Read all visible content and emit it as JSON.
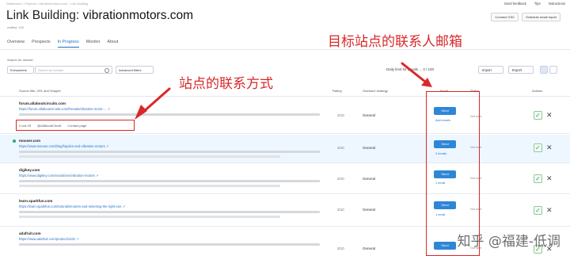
{
  "breadcrumb": "Dashboard  ›  Projects  ›  vibrationmotors.com  ›  Link Building",
  "top_links": [
    "Send feedback",
    "Tips",
    "Instructions"
  ],
  "page": {
    "title_prefix": "Link Building:",
    "title_domain": "vibrationmotors.com",
    "subtitle": "maillist: 100"
  },
  "header_buttons": [
    "Connect GSC",
    "Schedule email report"
  ],
  "tabs": [
    "Overview",
    "Prospects",
    "In Progress",
    "Monitor",
    "About"
  ],
  "filters": {
    "search_label": "Search for domain",
    "scope": "Everywhere",
    "search_placeholder": "Search by domain",
    "advanced": "Advanced filters",
    "daily_limit": "Daily limit for emails ... 3 / 100",
    "import": "Import",
    "export": "Export"
  },
  "columns": [
    "Source title, URL and Snippet",
    "Rating",
    "Outreach strategy",
    "Email",
    "Status",
    "Actions"
  ],
  "rows": [
    {
      "domain": "forum.allaboutcircuits.com",
      "url": "https://forum.allaboutcircuits.com/threads/vibration-motor-... ↗",
      "rating": "3/10",
      "strategy": "General",
      "email_btn": "Send",
      "email_count": "Add emails",
      "status": "Not sent",
      "contacts": [
        "f Link 93",
        "@AllAboutCircuit",
        "Contact page"
      ]
    },
    {
      "domain": "mouser.com",
      "url": "https://www.mouser.com/blog/haptics-and-vibration-motors ↗",
      "rating": "3/10",
      "strategy": "General",
      "email_btn": "Send",
      "email_count": "3 emails",
      "status": "Not sent"
    },
    {
      "domain": "digikey.com",
      "url": "https://www.digikey.com/en/articles/vibration-motors ↗",
      "rating": "3/10",
      "strategy": "General",
      "email_btn": "Send",
      "email_count": "1 email",
      "status": "Not sent"
    },
    {
      "domain": "learn.sparkfun.com",
      "url": "https://learn.sparkfun.com/tutorials/motors-and-selecting-the-right-one ↗",
      "rating": "3/10",
      "strategy": "General",
      "email_btn": "Send",
      "email_count": "1 email",
      "status": "Not sent"
    },
    {
      "domain": "adafruit.com",
      "url": "https://www.adafruit.com/product/1201 ↗",
      "rating": "3/10",
      "strategy": "General",
      "email_btn": "Send",
      "email_count": "",
      "status": "Not sent"
    }
  ],
  "annotations": {
    "contact_methods": "站点的联系方式",
    "contact_emails": "目标站点的联系人邮箱"
  },
  "watermark": "知乎 @福建-低调"
}
